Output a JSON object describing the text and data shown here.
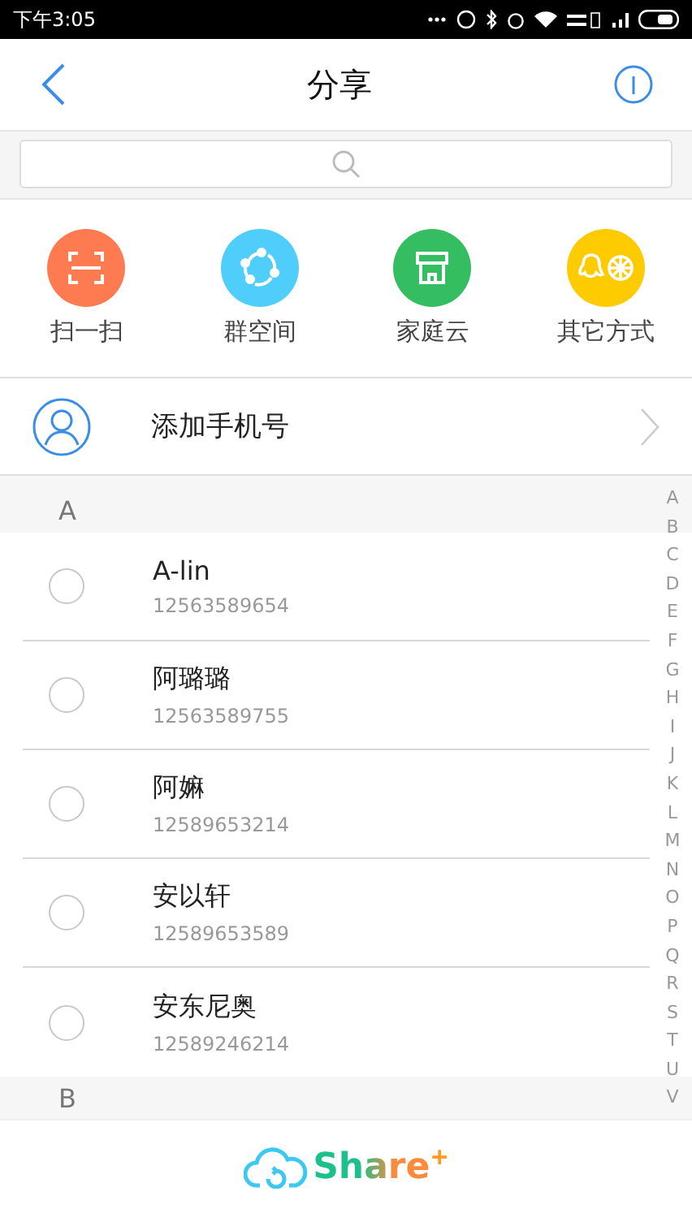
{
  "status_bar": {
    "time": "下午3:05"
  },
  "header": {
    "title": "分享"
  },
  "shortcuts": [
    {
      "label": "扫一扫",
      "kind": "scan",
      "color": "#fe7b52"
    },
    {
      "label": "群空间",
      "kind": "group",
      "color": "#4fcdfb"
    },
    {
      "label": "家庭云",
      "kind": "home",
      "color": "#35bd62"
    },
    {
      "label": "其它方式",
      "kind": "other",
      "color": "#fdcb00"
    }
  ],
  "add_phone": {
    "label": "添加手机号"
  },
  "sections": [
    {
      "letter": "A",
      "contacts": [
        {
          "name": "A-lin",
          "phone": "12563589654",
          "selected": false
        },
        {
          "name": "阿璐璐",
          "phone": "12563589755",
          "selected": false
        },
        {
          "name": "阿嫲",
          "phone": "12589653214",
          "selected": false
        },
        {
          "name": "安以轩",
          "phone": "12589653589",
          "selected": false
        },
        {
          "name": "安东尼奥",
          "phone": "12589246214",
          "selected": false
        }
      ]
    },
    {
      "letter": "B"
    }
  ],
  "index_letters": [
    "A",
    "B",
    "C",
    "D",
    "E",
    "F",
    "G",
    "H",
    "I",
    "J",
    "K",
    "L",
    "M",
    "N",
    "O",
    "P",
    "Q",
    "R",
    "S",
    "T",
    "U",
    "V"
  ],
  "footer": {
    "brand": "Share$^{+}$"
  }
}
